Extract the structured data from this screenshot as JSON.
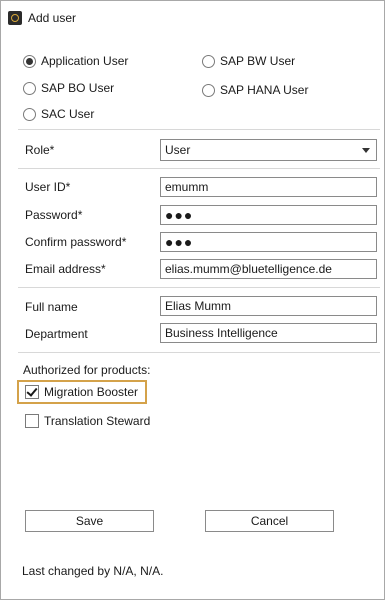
{
  "window": {
    "title": "Add user"
  },
  "user_types": [
    {
      "label": "Application User",
      "checked": true
    },
    {
      "label": "SAP BW User",
      "checked": false
    },
    {
      "label": "SAP BO User",
      "checked": false
    },
    {
      "label": "SAP HANA User",
      "checked": false
    },
    {
      "label": "SAC User",
      "checked": false
    }
  ],
  "role": {
    "label": "Role*",
    "value": "User"
  },
  "fields": {
    "user_id": {
      "label": "User ID*",
      "value": "emumm"
    },
    "password": {
      "label": "Password*",
      "value": "●●●"
    },
    "confirm_password": {
      "label": "Confirm password*",
      "value": "●●●"
    },
    "email": {
      "label": "Email address*",
      "value": "elias.mumm@bluetelligence.de"
    },
    "full_name": {
      "label": "Full name",
      "value": "Elias Mumm"
    },
    "department": {
      "label": "Department",
      "value": "Business Intelligence"
    }
  },
  "products": {
    "heading": "Authorized for products:",
    "items": [
      {
        "label": "Migration Booster",
        "checked": true
      },
      {
        "label": "Translation Steward",
        "checked": false
      }
    ]
  },
  "buttons": {
    "save": "Save",
    "cancel": "Cancel"
  },
  "footer": {
    "text": "Last changed by N/A, N/A."
  },
  "colors": {
    "focus_highlight": "#d4a24a"
  }
}
